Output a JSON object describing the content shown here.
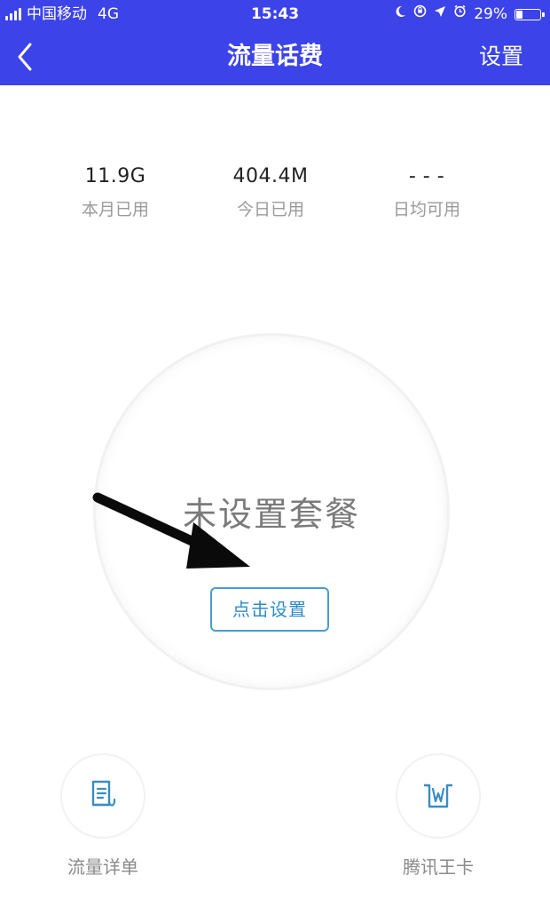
{
  "status_bar": {
    "carrier": "中国移动",
    "network": "4G",
    "time": "15:43",
    "battery": "29%",
    "battery_level": 0.29
  },
  "nav": {
    "title": "流量话费",
    "action_label": "设置"
  },
  "stats": [
    {
      "value": "11.9G",
      "label": "本月已用"
    },
    {
      "value": "404.4M",
      "label": "今日已用"
    },
    {
      "value": "- - -",
      "label": "日均可用"
    }
  ],
  "plan": {
    "status": "未设置套餐",
    "setup_button": "点击设置"
  },
  "shortcuts": [
    {
      "label": "流量详单",
      "icon": "document-list-icon"
    },
    {
      "label": "腾讯王卡",
      "icon": "king-card-icon"
    }
  ],
  "colors": {
    "header_bg": "#3c43e8",
    "accent": "#2e8ac6"
  }
}
